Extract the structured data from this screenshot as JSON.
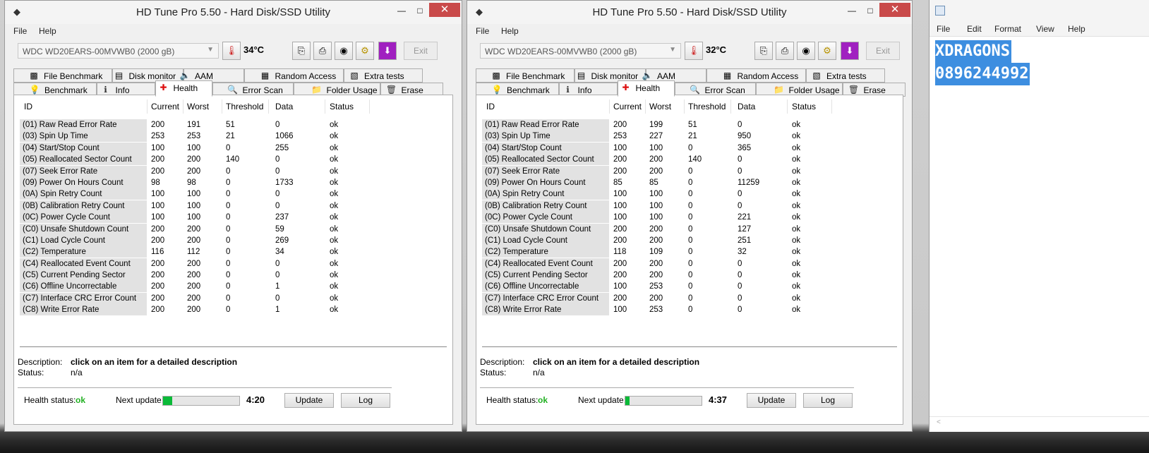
{
  "windows": [
    {
      "title": "HD Tune Pro 5.50 - Hard Disk/SSD Utility",
      "menu": [
        "File",
        "Help"
      ],
      "drive": "WDC WD20EARS-00MVWB0 (2000 gB)",
      "temperature": "34°C",
      "exit_label": "Exit",
      "tabs_top": [
        "File Benchmark",
        "Disk monitor",
        "AAM",
        "Random Access",
        "Extra tests"
      ],
      "tabs_bottom": [
        "Benchmark",
        "Info",
        "Health",
        "Error Scan",
        "Folder Usage",
        "Erase"
      ],
      "columns": [
        "ID",
        "Current",
        "Worst",
        "Threshold",
        "Data",
        "Status"
      ],
      "rows": [
        [
          "(01) Raw Read Error Rate",
          "200",
          "191",
          "51",
          "0",
          "ok"
        ],
        [
          "(03) Spin Up Time",
          "253",
          "253",
          "21",
          "1066",
          "ok"
        ],
        [
          "(04) Start/Stop Count",
          "100",
          "100",
          "0",
          "255",
          "ok"
        ],
        [
          "(05) Reallocated Sector Count",
          "200",
          "200",
          "140",
          "0",
          "ok"
        ],
        [
          "(07) Seek Error Rate",
          "200",
          "200",
          "0",
          "0",
          "ok"
        ],
        [
          "(09) Power On Hours Count",
          "98",
          "98",
          "0",
          "1733",
          "ok"
        ],
        [
          "(0A) Spin Retry Count",
          "100",
          "100",
          "0",
          "0",
          "ok"
        ],
        [
          "(0B) Calibration Retry Count",
          "100",
          "100",
          "0",
          "0",
          "ok"
        ],
        [
          "(0C) Power Cycle Count",
          "100",
          "100",
          "0",
          "237",
          "ok"
        ],
        [
          "(C0) Unsafe Shutdown Count",
          "200",
          "200",
          "0",
          "59",
          "ok"
        ],
        [
          "(C1) Load Cycle Count",
          "200",
          "200",
          "0",
          "269",
          "ok"
        ],
        [
          "(C2) Temperature",
          "116",
          "112",
          "0",
          "34",
          "ok"
        ],
        [
          "(C4) Reallocated Event Count",
          "200",
          "200",
          "0",
          "0",
          "ok"
        ],
        [
          "(C5) Current Pending Sector",
          "200",
          "200",
          "0",
          "0",
          "ok"
        ],
        [
          "(C6) Offline Uncorrectable",
          "200",
          "200",
          "0",
          "1",
          "ok"
        ],
        [
          "(C7) Interface CRC Error Count",
          "200",
          "200",
          "0",
          "0",
          "ok"
        ],
        [
          "(C8) Write Error Rate",
          "200",
          "200",
          "0",
          "1",
          "ok"
        ]
      ],
      "description_label": "Description:",
      "description_value": "click on an item for a detailed description",
      "status_label": "Status:",
      "status_value": "n/a",
      "health_label": "Health status:",
      "health_value": "ok",
      "next_update_label": "Next update:",
      "next_update_progress": 0.12,
      "timer": "4:20",
      "update_label": "Update",
      "log_label": "Log"
    },
    {
      "title": "HD Tune Pro 5.50 - Hard Disk/SSD Utility",
      "menu": [
        "File",
        "Help"
      ],
      "drive": "WDC WD20EARS-00MVWB0 (2000 gB)",
      "temperature": "32°C",
      "exit_label": "Exit",
      "tabs_top": [
        "File Benchmark",
        "Disk monitor",
        "AAM",
        "Random Access",
        "Extra tests"
      ],
      "tabs_bottom": [
        "Benchmark",
        "Info",
        "Health",
        "Error Scan",
        "Folder Usage",
        "Erase"
      ],
      "columns": [
        "ID",
        "Current",
        "Worst",
        "Threshold",
        "Data",
        "Status"
      ],
      "rows": [
        [
          "(01) Raw Read Error Rate",
          "200",
          "199",
          "51",
          "0",
          "ok"
        ],
        [
          "(03) Spin Up Time",
          "253",
          "227",
          "21",
          "950",
          "ok"
        ],
        [
          "(04) Start/Stop Count",
          "100",
          "100",
          "0",
          "365",
          "ok"
        ],
        [
          "(05) Reallocated Sector Count",
          "200",
          "200",
          "140",
          "0",
          "ok"
        ],
        [
          "(07) Seek Error Rate",
          "200",
          "200",
          "0",
          "0",
          "ok"
        ],
        [
          "(09) Power On Hours Count",
          "85",
          "85",
          "0",
          "11259",
          "ok"
        ],
        [
          "(0A) Spin Retry Count",
          "100",
          "100",
          "0",
          "0",
          "ok"
        ],
        [
          "(0B) Calibration Retry Count",
          "100",
          "100",
          "0",
          "0",
          "ok"
        ],
        [
          "(0C) Power Cycle Count",
          "100",
          "100",
          "0",
          "221",
          "ok"
        ],
        [
          "(C0) Unsafe Shutdown Count",
          "200",
          "200",
          "0",
          "127",
          "ok"
        ],
        [
          "(C1) Load Cycle Count",
          "200",
          "200",
          "0",
          "251",
          "ok"
        ],
        [
          "(C2) Temperature",
          "118",
          "109",
          "0",
          "32",
          "ok"
        ],
        [
          "(C4) Reallocated Event Count",
          "200",
          "200",
          "0",
          "0",
          "ok"
        ],
        [
          "(C5) Current Pending Sector",
          "200",
          "200",
          "0",
          "0",
          "ok"
        ],
        [
          "(C6) Offline Uncorrectable",
          "100",
          "253",
          "0",
          "0",
          "ok"
        ],
        [
          "(C7) Interface CRC Error Count",
          "200",
          "200",
          "0",
          "0",
          "ok"
        ],
        [
          "(C8) Write Error Rate",
          "100",
          "253",
          "0",
          "0",
          "ok"
        ]
      ],
      "description_label": "Description:",
      "description_value": "click on an item for a detailed description",
      "status_label": "Status:",
      "status_value": "n/a",
      "health_label": "Health status:",
      "health_value": "ok",
      "next_update_label": "Next update:",
      "next_update_progress": 0.06,
      "timer": "4:37",
      "update_label": "Update",
      "log_label": "Log"
    }
  ],
  "notepad": {
    "menu": [
      "File",
      "Edit",
      "Format",
      "View",
      "Help"
    ],
    "lines": [
      "XDRAGONS",
      "0896244992"
    ],
    "scroll_left": "<"
  },
  "colors": {
    "health_ok": "#22b022",
    "progress": "#0aba38",
    "selection": "#3d8ee0"
  },
  "icons": {
    "tabs_top": [
      "file-benchmark-icon",
      "disk-monitor-icon",
      "aam-speaker-icon",
      "random-access-icon",
      "extra-tests-icon"
    ],
    "tabs_bottom": [
      "benchmark-bulb-icon",
      "info-icon",
      "health-cross-icon",
      "error-scan-icon",
      "folder-usage-icon",
      "erase-trash-icon"
    ]
  }
}
